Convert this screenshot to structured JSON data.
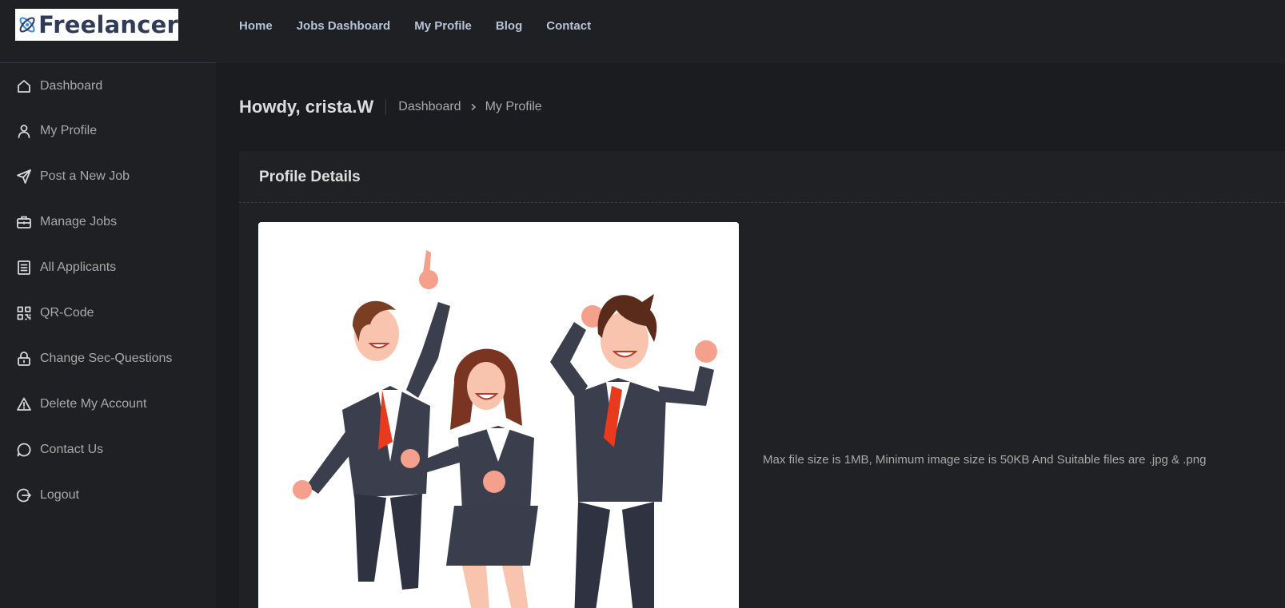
{
  "brand": {
    "logo_text": "Freelancer",
    "colors": {
      "accent": "#2f3b57",
      "mark": "#3a8dd8"
    }
  },
  "nav": {
    "items": [
      {
        "label": "Home"
      },
      {
        "label": "Jobs Dashboard"
      },
      {
        "label": "My Profile"
      },
      {
        "label": "Blog"
      },
      {
        "label": "Contact"
      }
    ]
  },
  "sidebar": {
    "items": [
      {
        "label": "Dashboard",
        "icon": "home-icon"
      },
      {
        "label": "My Profile",
        "icon": "user-icon"
      },
      {
        "label": "Post a New Job",
        "icon": "send-icon"
      },
      {
        "label": "Manage Jobs",
        "icon": "briefcase-icon"
      },
      {
        "label": "All Applicants",
        "icon": "list-icon"
      },
      {
        "label": "QR-Code",
        "icon": "qr-code-icon"
      },
      {
        "label": "Change Sec-Questions",
        "icon": "lock-icon"
      },
      {
        "label": "Delete My Account",
        "icon": "warning-icon"
      },
      {
        "label": "Contact Us",
        "icon": "chat-icon"
      },
      {
        "label": "Logout",
        "icon": "logout-icon"
      }
    ]
  },
  "header": {
    "greeting": "Howdy, crista.W",
    "breadcrumb": {
      "root": "Dashboard",
      "current": "My Profile"
    }
  },
  "profile": {
    "title": "Profile Details",
    "upload_hint": "Max file size is 1MB, Minimum image size is 50KB And Suitable files are .jpg & .png"
  }
}
